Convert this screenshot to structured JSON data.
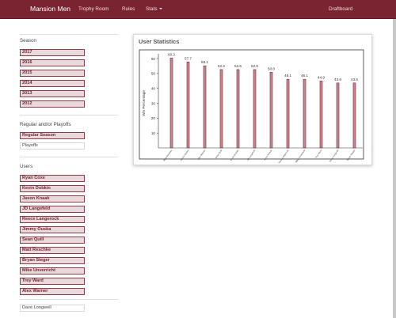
{
  "navbar": {
    "brand": "Mansion Men",
    "links": {
      "trophy_room": "Trophy Room",
      "rules": "Rules",
      "stats": "Stats",
      "draftboard": "Draftboard"
    }
  },
  "sidebar": {
    "season_label": "Season",
    "seasons": [
      "2017",
      "2016",
      "2015",
      "2014",
      "2013",
      "2012"
    ],
    "regular_label": "Regular and/or Playoffs",
    "regular_options": [
      "Regular Season",
      "Playoffs"
    ],
    "users_label": "Users",
    "users": [
      "Ryan Coxe",
      "Kevin Dobkin",
      "Jason Knaak",
      "JD Langefeld",
      "Reece Langerock",
      "Jimmy Ouska",
      "Sean Quill",
      "Matt Reschke",
      "Bryan Steger",
      "Mike Unverricht",
      "Trey Ward",
      "Alex Warner"
    ],
    "extra_user": "Dave Longwell"
  },
  "panel": {
    "title": "User Statistics"
  },
  "colors": {
    "brand": "#7a2431",
    "bar_fill": "#c98890",
    "bar_stroke": "#7a2431"
  },
  "chart_data": {
    "type": "bar",
    "ylabel": "Win Percentage",
    "ylim": [
      0,
      60
    ],
    "yticks": [
      10,
      20,
      30,
      40,
      50,
      60
    ],
    "categories": [
      "Matt Reschke",
      "Jimmy Ouska",
      "Alex Warner",
      "Sean Quill",
      "Kevin Dobkin",
      "JD Langefeld",
      "Jason Knaak",
      "Reece Langerock",
      "Mike Unverricht",
      "Trey Ward",
      "Dave Longwell",
      "Bryan Steger"
    ],
    "values": [
      60.3,
      57.7,
      55.1,
      52.6,
      52.6,
      52.6,
      50.8,
      46.1,
      46.1,
      44.9,
      43.6,
      43.6
    ],
    "value_labels": [
      "60.3",
      "57.7",
      "55.1",
      "52.6",
      "52.6",
      "52.6",
      "50.8",
      "46.1",
      "46.1",
      "44.9",
      "43.6",
      "43.6"
    ]
  }
}
